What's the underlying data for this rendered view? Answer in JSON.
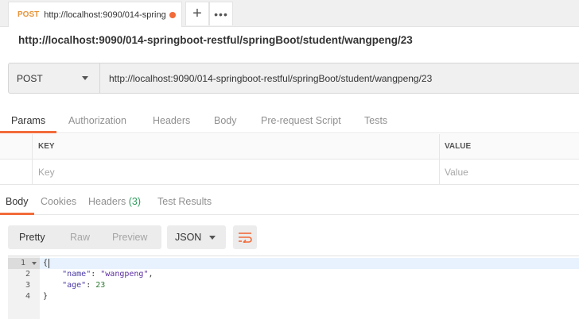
{
  "tab": {
    "method": "POST",
    "url_truncated": "http://localhost:9090/014-spring",
    "unsaved_dot_color": "#f26b3a",
    "add_icon": "+",
    "more_icon": "•••"
  },
  "request": {
    "name": "http://localhost:9090/014-springboot-restful/springBoot/student/wangpeng/23",
    "method": "POST",
    "url": "http://localhost:9090/014-springboot-restful/springBoot/student/wangpeng/23"
  },
  "request_tabs": [
    "Params",
    "Authorization",
    "Headers",
    "Body",
    "Pre-request Script",
    "Tests"
  ],
  "params": {
    "columns": [
      "KEY",
      "VALUE"
    ],
    "placeholders": {
      "key": "Key",
      "value": "Value"
    }
  },
  "response_tabs": {
    "body": "Body",
    "cookies": "Cookies",
    "headers_label": "Headers",
    "headers_count": "(3)",
    "test_results": "Test Results"
  },
  "format": {
    "pretty": "Pretty",
    "raw": "Raw",
    "preview": "Preview",
    "language": "JSON",
    "wrap_icon": "wrap-lines-icon"
  },
  "response_body": {
    "line_numbers": [
      "1",
      "2",
      "3",
      "4"
    ],
    "lines": [
      "{",
      "    \"name\": \"wangpeng\",",
      "    \"age\": 23",
      "}"
    ],
    "name_key": "\"name\"",
    "name_value": "\"wangpeng\"",
    "age_key": "\"age\"",
    "age_value": "23"
  },
  "colors": {
    "accent": "#f26b3a",
    "method_orange": "#e8943a",
    "count_green": "#2e9d5c"
  }
}
